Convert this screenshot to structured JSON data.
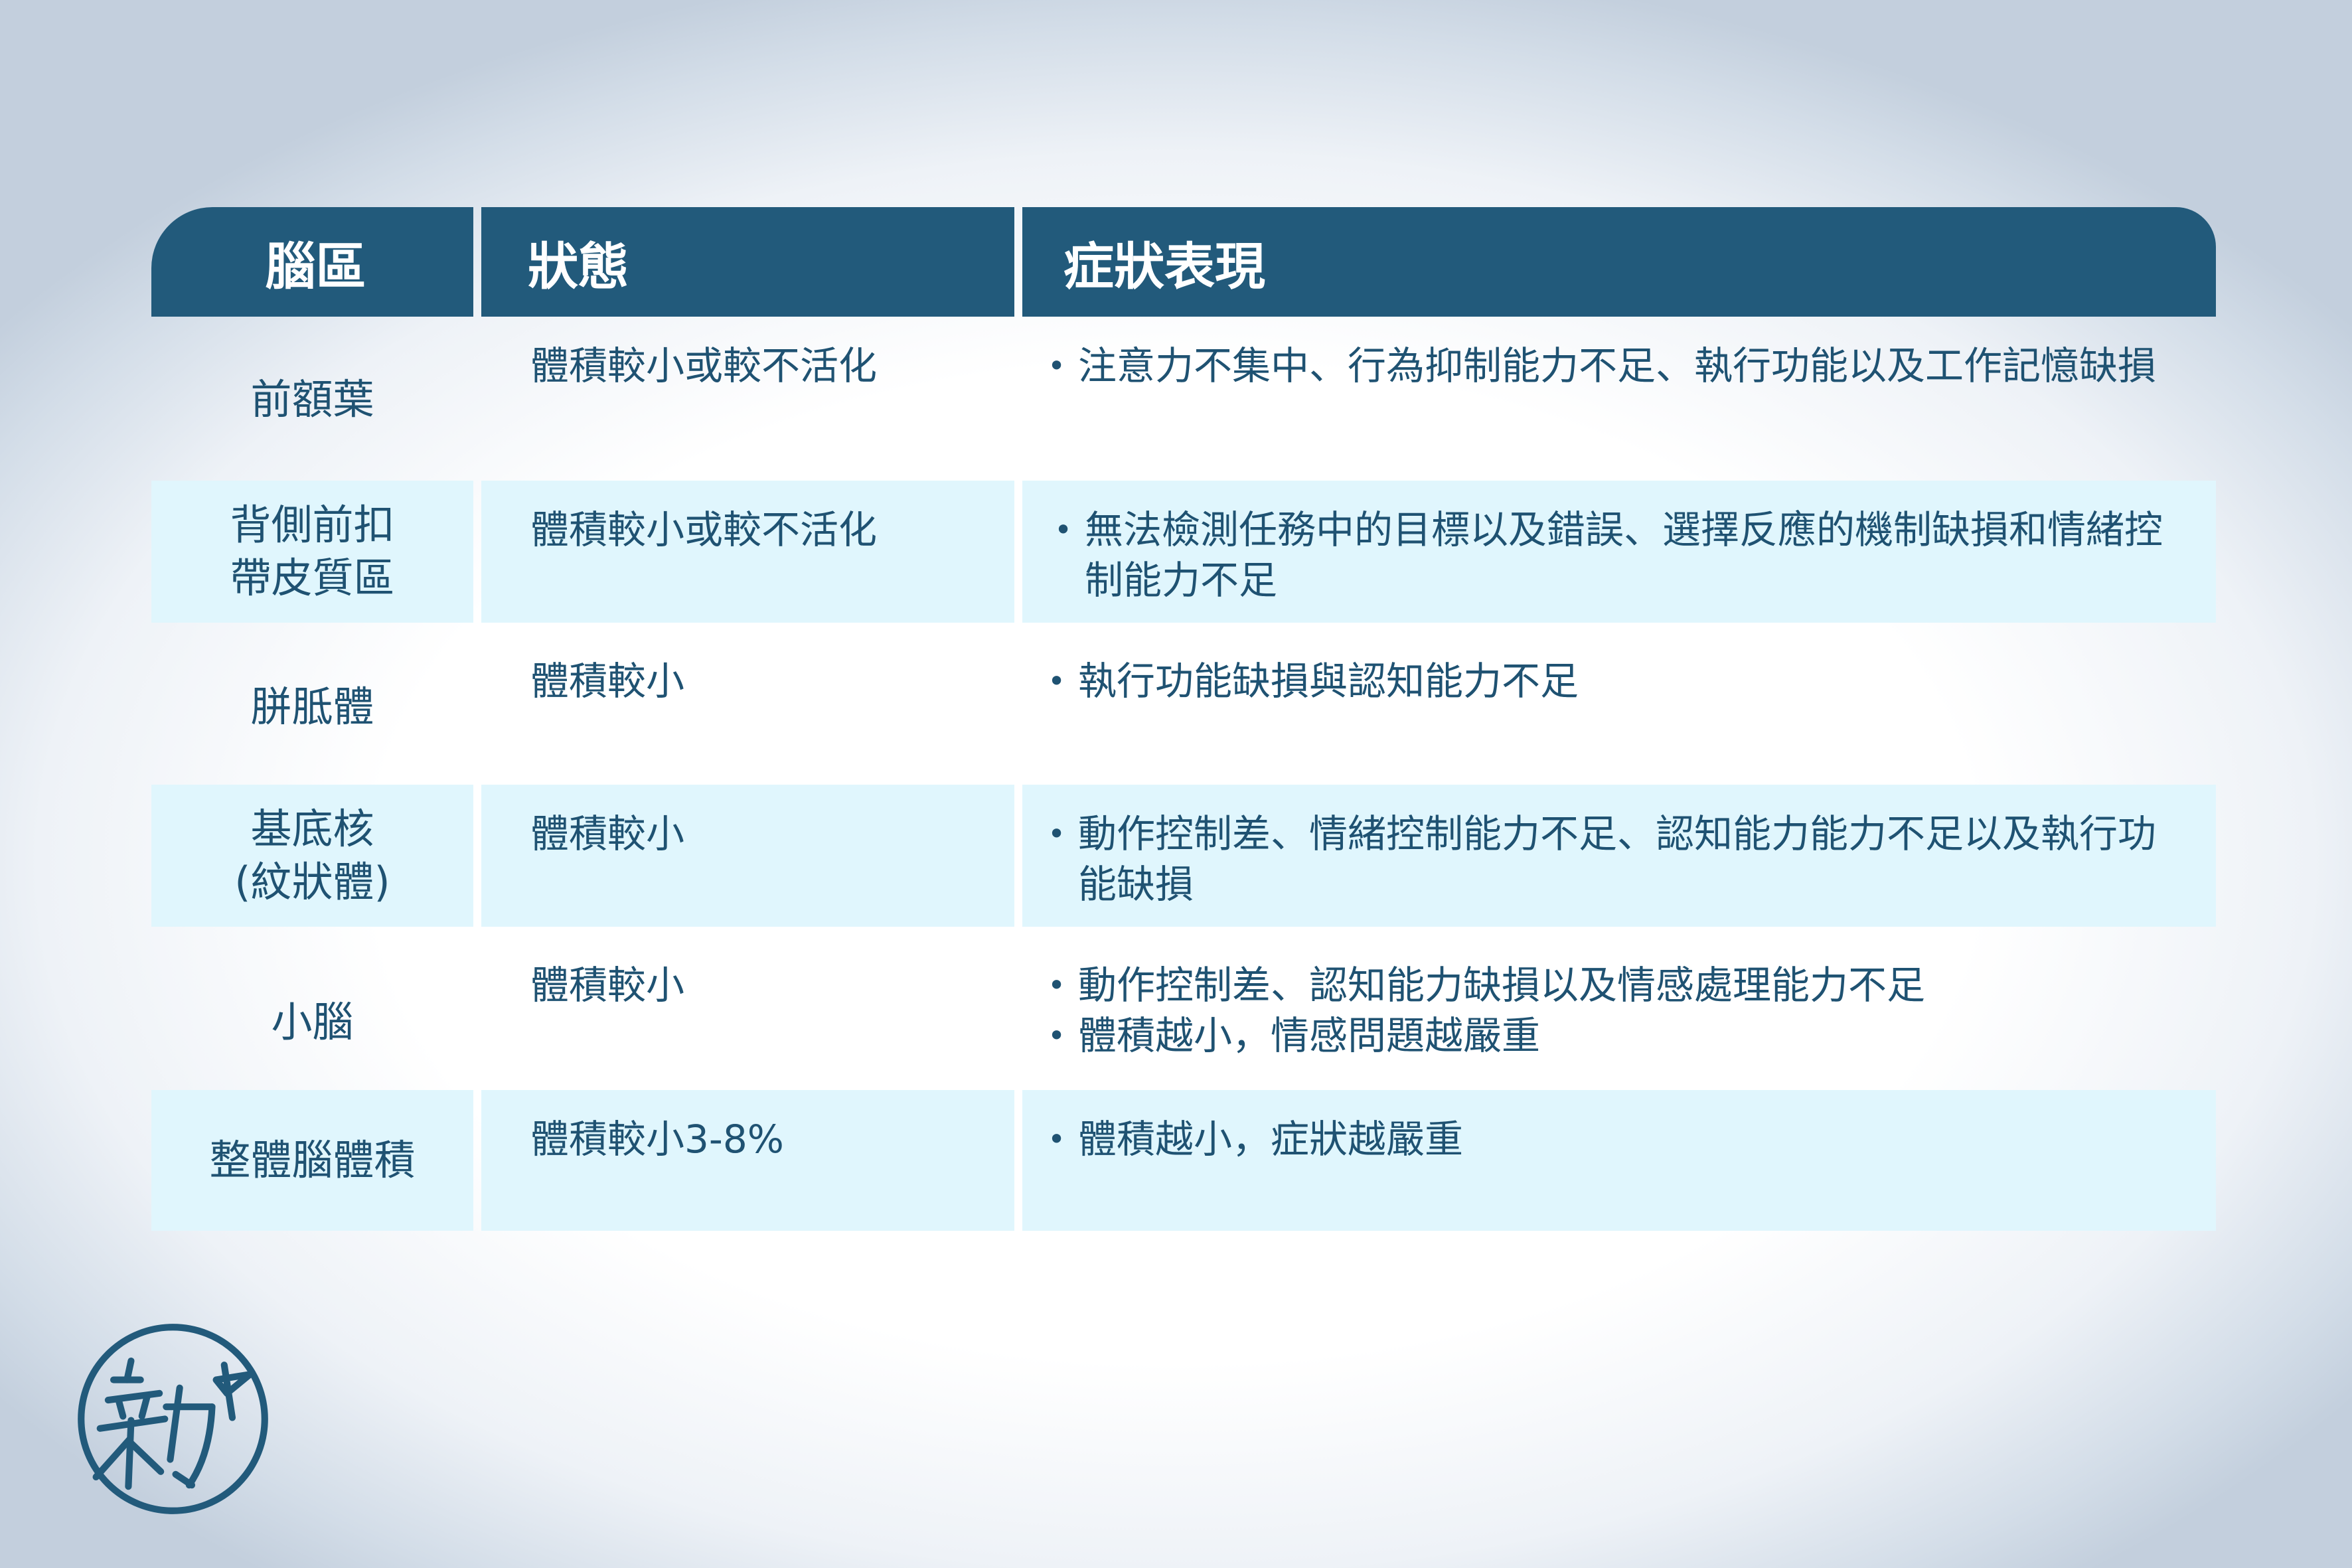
{
  "table": {
    "headers": [
      "腦區",
      "狀態",
      "症狀表現"
    ],
    "rows": [
      {
        "region": "前額葉",
        "state": "體積較小或較不活化",
        "symptoms": [
          "注意力不集中、行為抑制能力不足、執行功能以及工作記憶缺損"
        ]
      },
      {
        "region": "背側前扣\n帶皮質區",
        "state": "體積較小或較不活化",
        "symptoms": [
          "無法檢測任務中的目標以及錯誤、選擇反應的機制缺損和情緒控制能力不足"
        ]
      },
      {
        "region": "胼胝體",
        "state": "體積較小",
        "symptoms": [
          "執行功能缺損與認知能力不足"
        ]
      },
      {
        "region": "基底核\n(紋狀體)",
        "state": "體積較小",
        "symptoms": [
          "動作控制差、情緒控制能力不足、認知能力能力不足以及執行功能缺損"
        ]
      },
      {
        "region": "小腦",
        "state": "體積較小",
        "symptoms": [
          "動作控制差、認知能力缺損以及情感處理能力不足",
          "體積越小，情感問題越嚴重"
        ]
      },
      {
        "region": "整體腦體積",
        "state": "體積較小3-8%",
        "symptoms": [
          "體積越小，症狀越嚴重"
        ]
      }
    ],
    "bullet": "•"
  },
  "logo": {
    "icon": "circle-brush-logo-icon",
    "text": "新"
  },
  "colors": {
    "header_bg": "#225a7b",
    "row_shade": "#e0f6fd",
    "text": "#1f5272"
  }
}
